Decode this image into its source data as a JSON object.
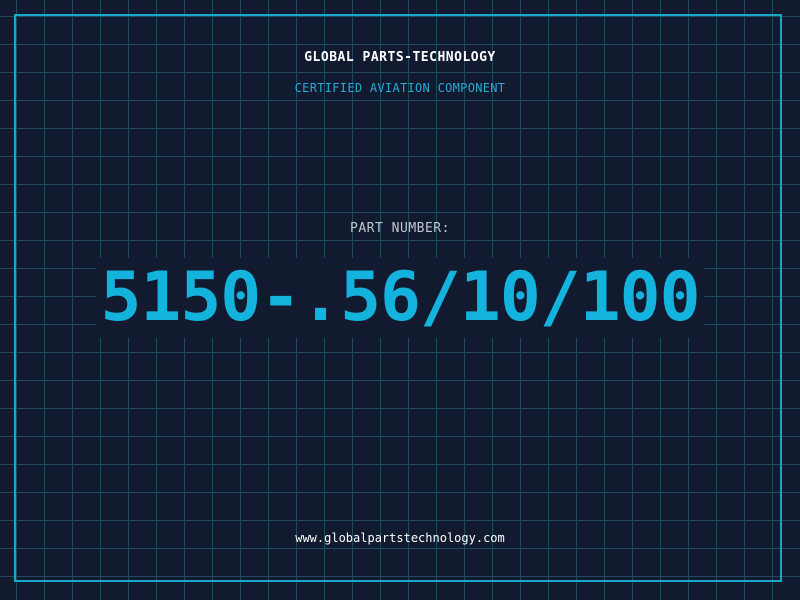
{
  "header": {
    "company_name": "GLOBAL PARTS-TECHNOLOGY",
    "subtitle": "CERTIFIED AVIATION COMPONENT"
  },
  "part": {
    "label": "PART NUMBER:",
    "number": "5150-.56/10/100"
  },
  "footer": {
    "website": "www.globalpartstechnology.com"
  },
  "colors": {
    "background": "#111a2e",
    "grid": "#1d4a5e",
    "accent": "#14b3de",
    "frame": "#1aa6c8"
  }
}
